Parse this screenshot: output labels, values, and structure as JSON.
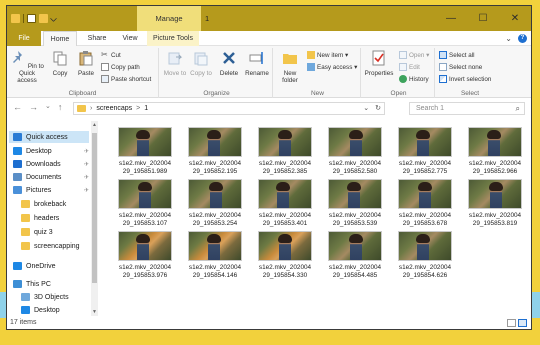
{
  "titlebar": {
    "context_tab": "Manage",
    "title": "1",
    "minimize": "—",
    "maximize": "☐",
    "close": "✕"
  },
  "tabs": {
    "file": "File",
    "home": "Home",
    "share": "Share",
    "view": "View",
    "picture_tools": "Picture Tools",
    "expand": "⌄",
    "help": "?"
  },
  "ribbon": {
    "clipboard": {
      "label": "Clipboard",
      "pin": "Pin to Quick access",
      "copy": "Copy",
      "paste": "Paste",
      "cut": "Cut",
      "copy_path": "Copy path",
      "paste_shortcut": "Paste shortcut"
    },
    "organize": {
      "label": "Organize",
      "move_to": "Move to",
      "copy_to": "Copy to",
      "delete": "Delete",
      "rename": "Rename"
    },
    "new": {
      "label": "New",
      "new_folder": "New folder",
      "new_item": "New item ▾",
      "easy_access": "Easy access ▾"
    },
    "open": {
      "label": "Open",
      "properties": "Properties",
      "open": "Open ▾",
      "edit": "Edit",
      "history": "History"
    },
    "select": {
      "label": "Select",
      "select_all": "Select all",
      "select_none": "Select none",
      "invert": "Invert selection"
    }
  },
  "address": {
    "back": "←",
    "forward": "→",
    "recent": "⌄",
    "up": "↑",
    "path_sep1": "›",
    "path_part1": "screencaps",
    "path_sep2": ">",
    "path_part2": "1",
    "dropdown": "⌄",
    "refresh": "↻",
    "search_placeholder": "Search 1",
    "search_icon": "⌕"
  },
  "nav": {
    "items": [
      {
        "label": "Quick access",
        "icon": "star-icon",
        "color": "#2a7bd4",
        "pinned": false
      },
      {
        "label": "Desktop",
        "icon": "desktop-icon",
        "color": "#1e88e5",
        "pinned": true
      },
      {
        "label": "Downloads",
        "icon": "download-icon",
        "color": "#1e6fd0",
        "pinned": true
      },
      {
        "label": "Documents",
        "icon": "documents-icon",
        "color": "#5b8fc7",
        "pinned": true
      },
      {
        "label": "Pictures",
        "icon": "pictures-icon",
        "color": "#4a90d9",
        "pinned": true
      },
      {
        "label": "brokeback",
        "icon": "folder-icon",
        "color": "#f2c54b",
        "pinned": false
      },
      {
        "label": "headers",
        "icon": "folder-icon",
        "color": "#f2c54b",
        "pinned": false
      },
      {
        "label": "quiz 3",
        "icon": "folder-icon",
        "color": "#f2c54b",
        "pinned": false
      },
      {
        "label": "screencapping",
        "icon": "folder-icon",
        "color": "#f2c54b",
        "pinned": false
      },
      {
        "label": "OneDrive",
        "icon": "onedrive-icon",
        "color": "#1e88e5",
        "pinned": false
      },
      {
        "label": "This PC",
        "icon": "computer-icon",
        "color": "#3d8fd6",
        "pinned": false
      },
      {
        "label": "3D Objects",
        "icon": "3d-objects-icon",
        "color": "#6fa8dc",
        "pinned": false
      },
      {
        "label": "Desktop",
        "icon": "desktop-icon",
        "color": "#1e88e5",
        "pinned": false
      }
    ],
    "pin_glyph": "✈"
  },
  "files": [
    {
      "line1": "s1e2.mkv_202004",
      "line2": "29_195851.989"
    },
    {
      "line1": "s1e2.mkv_202004",
      "line2": "29_195852.195"
    },
    {
      "line1": "s1e2.mkv_202004",
      "line2": "29_195852.385"
    },
    {
      "line1": "s1e2.mkv_202004",
      "line2": "29_195852.580"
    },
    {
      "line1": "s1e2.mkv_202004",
      "line2": "29_195852.775"
    },
    {
      "line1": "s1e2.mkv_202004",
      "line2": "29_195852.966"
    },
    {
      "line1": "s1e2.mkv_202004",
      "line2": "29_195853.107"
    },
    {
      "line1": "s1e2.mkv_202004",
      "line2": "29_195853.254"
    },
    {
      "line1": "s1e2.mkv_202004",
      "line2": "29_195853.401"
    },
    {
      "line1": "s1e2.mkv_202004",
      "line2": "29_195853.539"
    },
    {
      "line1": "s1e2.mkv_202004",
      "line2": "29_195853.678"
    },
    {
      "line1": "s1e2.mkv_202004",
      "line2": "29_195853.819"
    },
    {
      "line1": "s1e2.mkv_202004",
      "line2": "29_195853.976"
    },
    {
      "line1": "s1e2.mkv_202004",
      "line2": "29_195854.146"
    },
    {
      "line1": "s1e2.mkv_202004",
      "line2": "29_195854.330"
    },
    {
      "line1": "s1e2.mkv_202004",
      "line2": "29_195854.485"
    },
    {
      "line1": "s1e2.mkv_202004",
      "line2": "29_195854.626"
    }
  ],
  "status": {
    "count": "17 items"
  },
  "colors": {
    "titlebar": "#b59a1c",
    "accent": "#1e6fd0",
    "selection": "#cce5f7"
  }
}
